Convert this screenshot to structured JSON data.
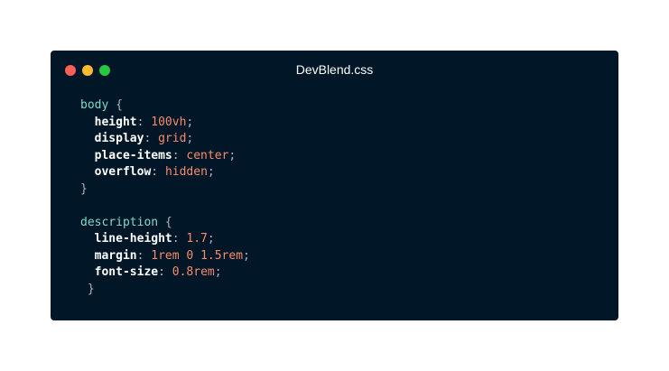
{
  "window": {
    "title": "DevBlend.css",
    "controls": [
      {
        "name": "close",
        "color": "#ff5f57"
      },
      {
        "name": "minimize",
        "color": "#febc2e"
      },
      {
        "name": "maximize",
        "color": "#28c840"
      }
    ]
  },
  "code": {
    "blocks": [
      {
        "selector": "body",
        "open": " {",
        "declarations": [
          {
            "property": "height",
            "value": "100vh"
          },
          {
            "property": "display",
            "value": "grid"
          },
          {
            "property": "place-items",
            "value": "center"
          },
          {
            "property": "overflow",
            "value": "hidden"
          }
        ],
        "close": "}"
      },
      {
        "selector": "description",
        "open": " {",
        "declarations": [
          {
            "property": "line-height",
            "value": "1.7"
          },
          {
            "property": "margin",
            "value": "1rem 0 1.5rem"
          },
          {
            "property": "font-size",
            "value": "0.8rem"
          }
        ],
        "close": " }"
      }
    ]
  },
  "colors": {
    "background": "#011627",
    "selector": "#7fdbca",
    "property": "#ffffff",
    "value": "#f78c6c",
    "punctuation": "#aab4c2"
  }
}
